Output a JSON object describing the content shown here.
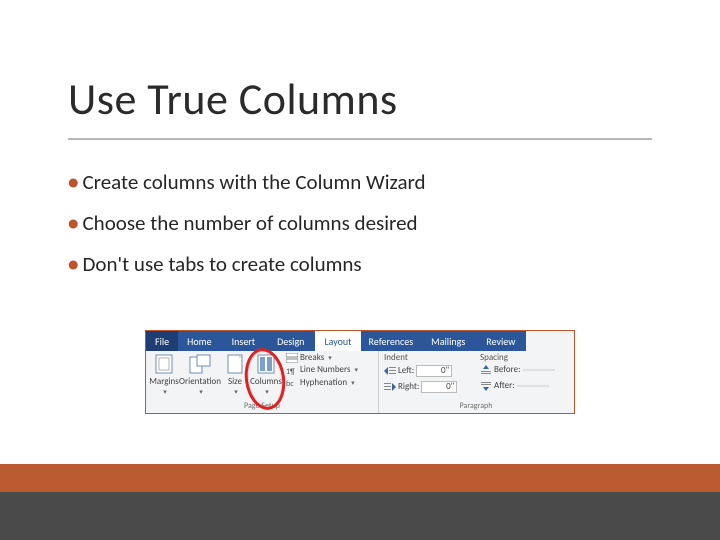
{
  "title": "Use True Columns",
  "bullets": [
    "Create columns with the Column Wizard",
    "Choose the number of columns desired",
    "Don't use tabs to create columns"
  ],
  "ribbon": {
    "tabs": [
      "File",
      "Home",
      "Insert",
      "Design",
      "Layout",
      "References",
      "Mailings",
      "Review"
    ],
    "page_setup": {
      "margins": "Margins",
      "orientation": "Orientation",
      "size": "Size",
      "columns": "Columns",
      "breaks": "Breaks",
      "line_numbers": "Line Numbers",
      "hyphenation": "Hyphenation",
      "caption": "Page Setup"
    },
    "indent": {
      "caption": "Indent",
      "left_label": "Left:",
      "left_value": "0\"",
      "right_label": "Right:",
      "right_value": "0\""
    },
    "spacing": {
      "caption": "Spacing",
      "before_label": "Before:",
      "after_label": "After:"
    },
    "paragraph_caption": "Paragraph"
  }
}
